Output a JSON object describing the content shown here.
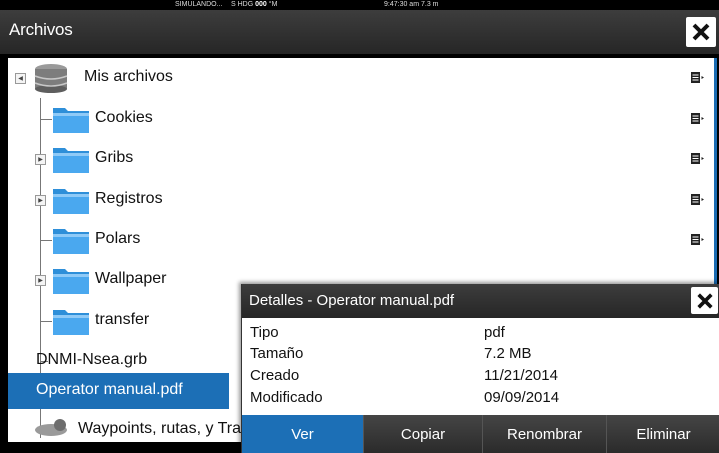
{
  "status": {
    "mode": "SIMULANDO...",
    "hdg_label": "S HDG",
    "hdg_value": "000",
    "hdg_unit": "°M",
    "time": "9:47:30 am",
    "extra": "7.3 m"
  },
  "window": {
    "title": "Archivos"
  },
  "tree": {
    "root_label": "Mis archivos",
    "items": [
      {
        "label": "Cookies"
      },
      {
        "label": "Gribs"
      },
      {
        "label": "Registros"
      },
      {
        "label": "Polars"
      },
      {
        "label": "Wallpaper"
      },
      {
        "label": "transfer"
      },
      {
        "label": "DNMI-Nsea.grb"
      },
      {
        "label": "Operator manual.pdf"
      },
      {
        "label": "Waypoints, rutas, y Tracks"
      }
    ]
  },
  "details": {
    "title": "Detalles - Operator manual.pdf",
    "rows": [
      {
        "key": "Tipo",
        "value": "pdf"
      },
      {
        "key": "Tamaño",
        "value": "7.2 MB"
      },
      {
        "key": "Creado",
        "value": "11/21/2014"
      },
      {
        "key": "Modificado",
        "value": "09/09/2014"
      }
    ],
    "buttons": {
      "view": "Ver",
      "copy": "Copiar",
      "rename": "Renombrar",
      "delete": "Eliminar"
    }
  },
  "colors": {
    "accent": "#1c6fb6",
    "titlebar": "#2e2e2e"
  }
}
